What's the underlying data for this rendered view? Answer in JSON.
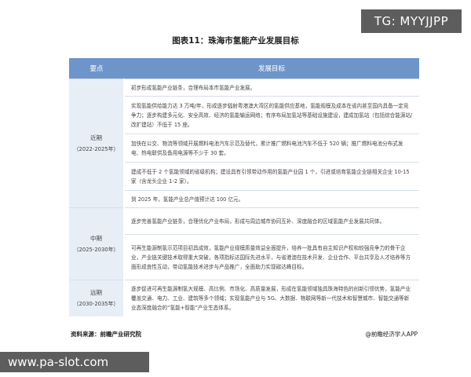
{
  "tg_badge": "TG: MYYJJPP",
  "title": "图表11：珠海市氢能产业发展目标",
  "table": {
    "headers": [
      "要点",
      "发展目标"
    ],
    "periods": [
      {
        "name": "近期",
        "years": "（2022-2025年）",
        "goals": [
          "初步形成氢能产业链条，合理布局本市氢能产业发展。",
          "实现氢能供给能力达 3 万吨/年，形成逐步辐射粤港澳大湾区的氢能供应基地，氢能规模及成本在省内甚至国内具备一定竞争力；逐步构建多元化、安全高效、经济的氢能输运网络；有序布局加氢站等基础设施建设，建成加氢站（包括综合能源站/改扩建站）不低于 15 座。",
          "加快在公交、物流等领域开展燃料电池汽车示范及替代，累计推广燃料电池汽车不低于 520 辆；推广燃料电池分布式发电、热电联供及备用电源等不少于 30 套。",
          "建成不低于 2 个氢能领域的省级机构；建设具有引领带动作用的氢能产业园 1 个，引进或培育氢能企业链相关企业 10-15 家（含龙头企业 1-2 家）。",
          "到 2025 年，氢能产业总产值预计达 100 亿元。"
        ]
      },
      {
        "name": "中期",
        "years": "（2025-2030年）",
        "goals": [
          "逐步完善氢能产业链条，合理优化产业布局，形成与周边城市协同互补、深度融合的区域氢能产业发展共同体。",
          "可再生能源制氢示范项目初具成效，氢能产业规模质量效益全面提升，培养一批具有自主知识产权和较强竞争力的骨干企业，产业链关键技术取得重大突破，各项指标达国际先进水平，与省港澳在技术开发、企业合作、平台共享及人才培养等方面形成良性互动，带动氢能技术进步与产品推广，全面助力实现碳达峰目标。"
        ]
      },
      {
        "name": "远期",
        "years": "（2030-2035年）",
        "goals": [
          "逐步促进可再生能源制氢大规模、高比例、市场化、高质量发展，形成在氢能领域独具珠海特色的创新引领优势，氢能产业覆盖交通、电力、工业、建筑等多个领域；实现氢能产业与 5G、大数据、物联网等新一代技术和智慧城市、智能交通等新业态深度融合的“氢能+智能”产业生态体系。"
        ]
      }
    ]
  },
  "footer": {
    "source": "资料来源：前瞻产业研究院",
    "brand": "@前瞻经济学人APP"
  },
  "watermark": "www.pa-slot.com"
}
